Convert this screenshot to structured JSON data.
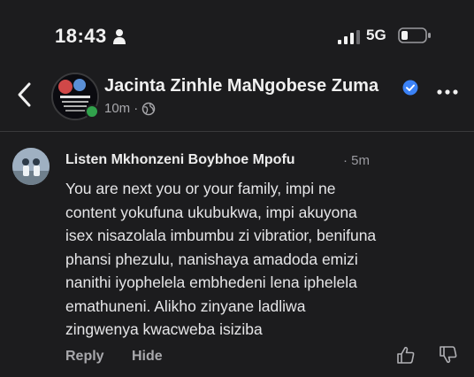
{
  "status_bar": {
    "time": "18:43",
    "network": "5G"
  },
  "header": {
    "page_name": "Jacinta Zinhle MaNgobese Zuma",
    "time_ago": "10m",
    "separator": "·"
  },
  "comment": {
    "author": "Listen Mkhonzeni Boybhoe Mpofu",
    "time_ago": "· 5m",
    "text": "You are next you or your family, impi ne\ncontent yokufuna ukubukwa, impi akuyona\nisex nisazolala imbumbu zi vibratior,  benifuna\nphansi phezulu,  nanishaya amadoda emizi\nnanithi iyophelela embhedeni lena iphelela\nemathuneni.   Alikho zinyane ladliwa\nzingwenya kwacweba isiziba",
    "reply_label": "Reply",
    "hide_label": "Hide"
  },
  "colors": {
    "background": "#1c1c1e",
    "verified": "#3b82f6",
    "online": "#31a24c"
  },
  "icons": [
    "person-icon",
    "signal-icon",
    "battery-icon",
    "back-arrow-icon",
    "verified-badge-icon",
    "globe-icon",
    "more-options-icon",
    "thumbs-up-icon",
    "thumbs-down-icon"
  ]
}
